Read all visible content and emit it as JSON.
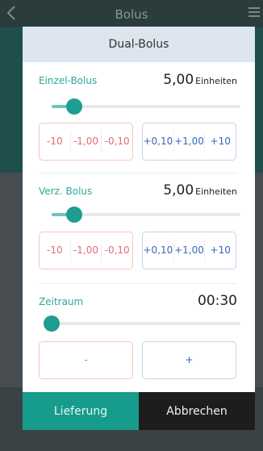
{
  "background": {
    "title": "Bolus",
    "back_icon": "chevron-left-icon",
    "menu_icon": "hamburger-icon"
  },
  "modal": {
    "title": "Dual-Bolus",
    "sections": [
      {
        "label": "Einzel-Bolus",
        "value": "5,00",
        "unit": "Einheiten",
        "slider_fraction": 0.12,
        "decrement_buttons": [
          "-10",
          "-1,00",
          "-0,10"
        ],
        "increment_buttons": [
          "+0,10",
          "+1,00",
          "+10"
        ]
      },
      {
        "label": "Verz. Bolus",
        "value": "5,00",
        "unit": "Einheiten",
        "slider_fraction": 0.12,
        "decrement_buttons": [
          "-10",
          "-1,00",
          "-0,10"
        ],
        "increment_buttons": [
          "+0,10",
          "+1,00",
          "+10"
        ]
      },
      {
        "label": "Zeitraum",
        "value": "00:30",
        "slider_fraction": 0.0,
        "decrement_buttons": [
          "-"
        ],
        "increment_buttons": [
          "+"
        ]
      }
    ],
    "footer": {
      "confirm_label": "Lieferung",
      "cancel_label": "Abbrechen"
    }
  },
  "colors": {
    "accent": "#1f9d91",
    "negative": "#e36a78",
    "positive": "#3a66b8"
  }
}
